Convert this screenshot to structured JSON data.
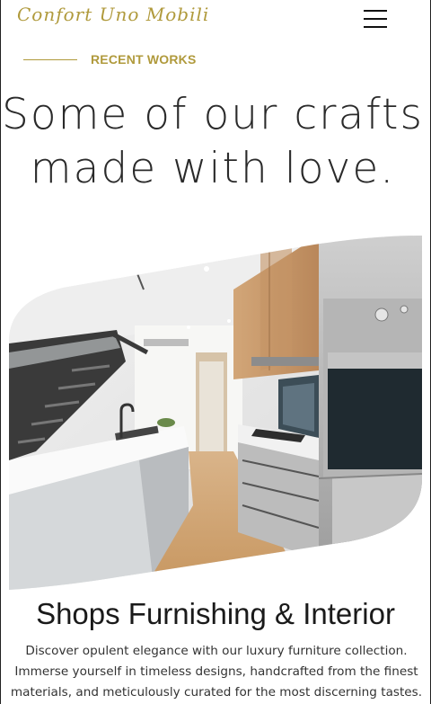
{
  "header": {
    "logo_text": "Confort Uno Mobili",
    "menu_icon": "hamburger-menu-icon"
  },
  "section": {
    "eyebrow": "RECENT WORKS",
    "headline_line1": "Some of our crafts",
    "headline_line2": "made with love."
  },
  "hero_image": {
    "subject": "modern kitchen with wood cabinets, white island and staircase"
  },
  "project": {
    "title": "Shops Furnishing & Interior",
    "description": "Discover opulent elegance with our luxury furniture collection. Immerse yourself in timeless designs, handcrafted from the finest materials, and meticulously curated for the most discerning tastes."
  },
  "colors": {
    "accent_gold": "#b09a3c",
    "heading_dark": "#2a2a2a",
    "body_text": "#333333"
  }
}
